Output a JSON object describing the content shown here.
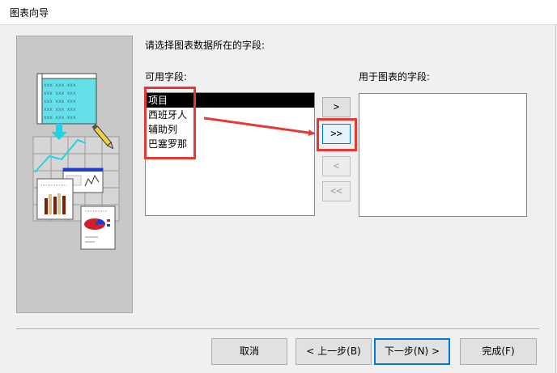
{
  "window": {
    "title": "图表向导"
  },
  "instruction": "请选择图表数据所在的字段:",
  "available": {
    "label": "可用字段:",
    "items": [
      "项目",
      "西班牙人",
      "辅助列",
      "巴塞罗那"
    ]
  },
  "chart_fields": {
    "label": "用于图表的字段:",
    "items": []
  },
  "move_buttons": {
    "add_one": ">",
    "add_all": ">>",
    "remove_one": "<",
    "remove_all": "<<"
  },
  "footer": {
    "cancel": "取消",
    "back": "< 上一步(B)",
    "next": "下一步(N) >",
    "finish": "完成(F)"
  },
  "colors": {
    "highlight": "#e53935",
    "illustration_bg": "#c8c8c8",
    "sheet_cyan": "#66e0e8",
    "arrow_cyan": "#22d3e6",
    "bar_dark": "#7a1f0f",
    "bar_light": "#d8c08a",
    "pie_red": "#d11f2b",
    "pie_blue": "#1f3bd1"
  }
}
